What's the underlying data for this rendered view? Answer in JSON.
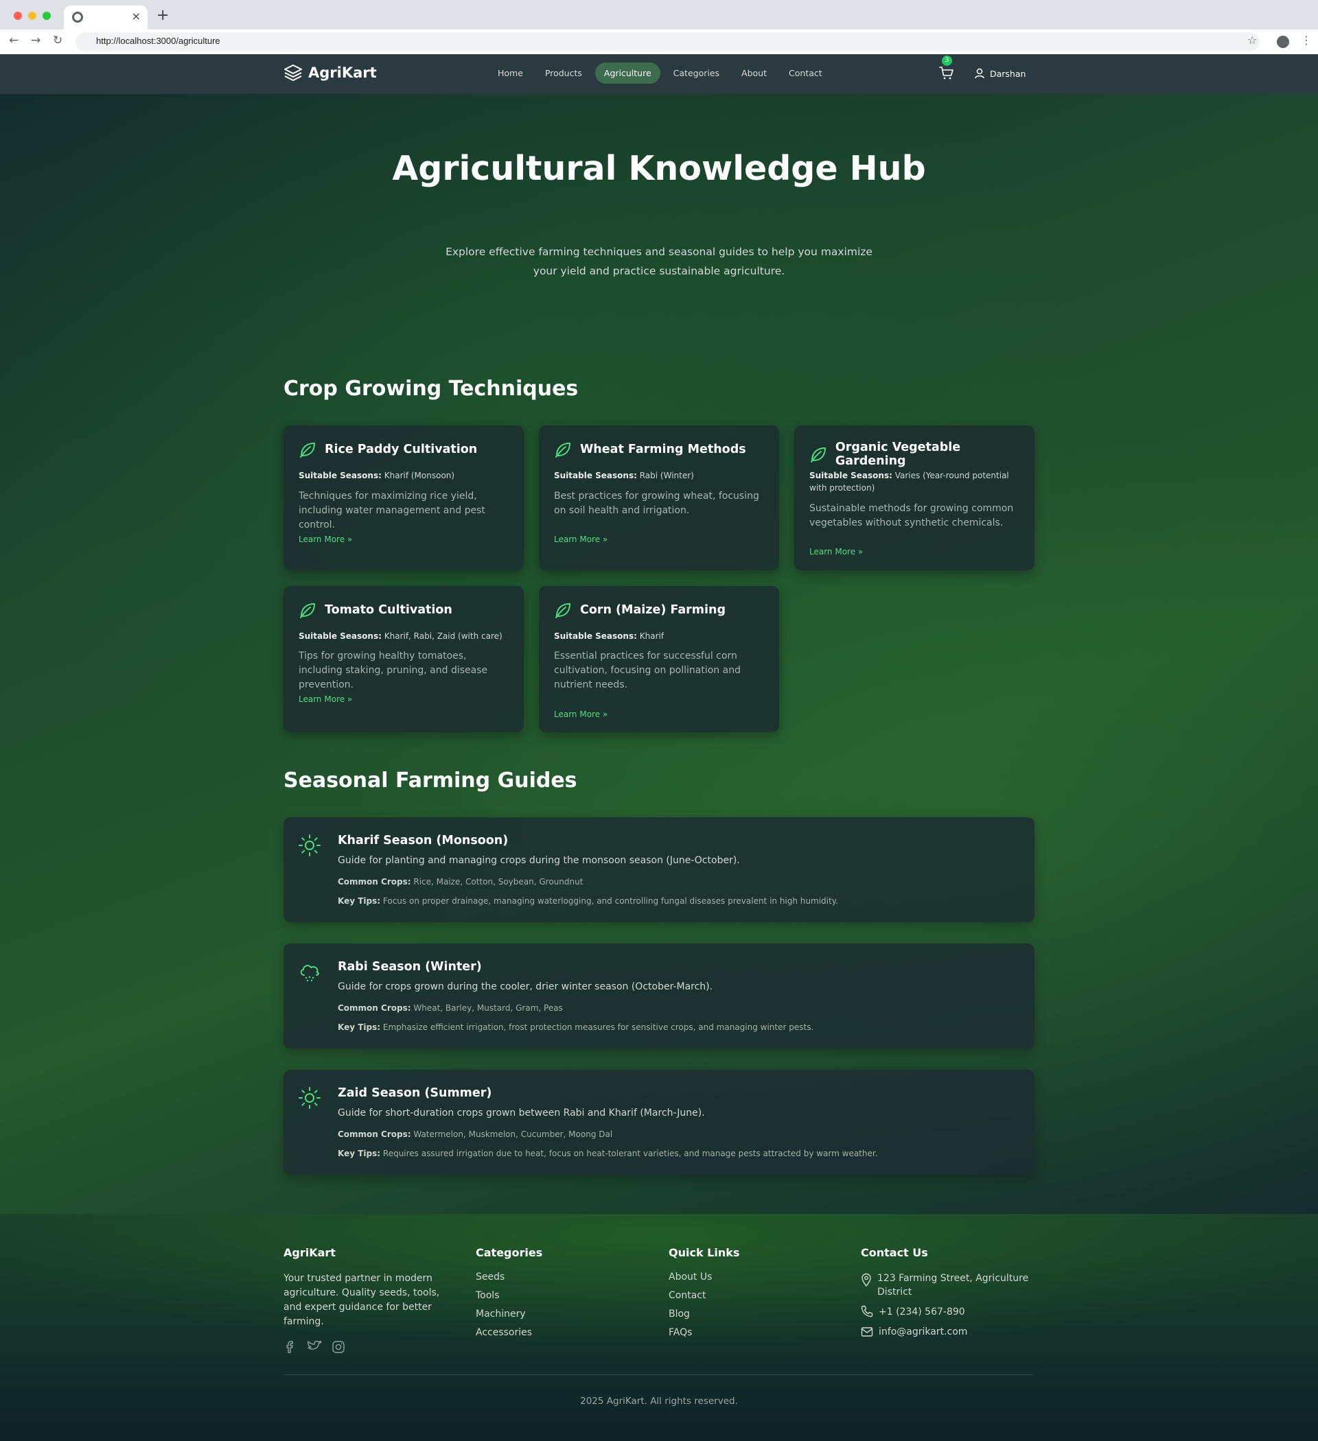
{
  "browser": {
    "url": "http://localhost:3000/agriculture",
    "new_tab": "+",
    "close_tab": "×"
  },
  "header": {
    "brand": "AgriKart",
    "nav": [
      {
        "label": "Home",
        "active": false
      },
      {
        "label": "Products",
        "active": false
      },
      {
        "label": "Agriculture",
        "active": true
      },
      {
        "label": "Categories",
        "active": false
      },
      {
        "label": "About",
        "active": false
      },
      {
        "label": "Contact",
        "active": false
      }
    ],
    "cart_count": "3",
    "user_name": "Darshan"
  },
  "hero": {
    "title": "Agricultural Knowledge Hub",
    "subtitle": "Explore effective farming techniques and seasonal guides to help you maximize your yield and practice sustainable agriculture."
  },
  "techniques": {
    "heading": "Crop Growing Techniques",
    "seasons_label": "Suitable Seasons:",
    "link_label": "Learn More »",
    "cards": [
      {
        "title": "Rice Paddy Cultivation",
        "seasons": "Kharif (Monsoon)",
        "desc": "Techniques for maximizing rice yield, including water management and pest control.",
        "icon": "leaf-icon"
      },
      {
        "title": "Wheat Farming Methods",
        "seasons": "Rabi (Winter)",
        "desc": "Best practices for growing wheat, focusing on soil health and irrigation.",
        "icon": "leaf-icon"
      },
      {
        "title": "Organic Vegetable Gardening",
        "seasons": "Varies (Year-round potential with protection)",
        "desc": "Sustainable methods for growing common vegetables without synthetic chemicals.",
        "icon": "leaf-icon"
      },
      {
        "title": "Tomato Cultivation",
        "seasons": "Kharif, Rabi, Zaid (with care)",
        "desc": "Tips for growing healthy tomatoes, including staking, pruning, and disease prevention.",
        "icon": "leaf-icon"
      },
      {
        "title": "Corn (Maize) Farming",
        "seasons": "Kharif",
        "desc": "Essential practices for successful corn cultivation, focusing on pollination and nutrient needs.",
        "icon": "leaf-icon"
      }
    ]
  },
  "guides": {
    "heading": "Seasonal Farming Guides",
    "crops_label": "Common Crops:",
    "tips_label": "Key Tips:",
    "items": [
      {
        "title": "Kharif Season (Monsoon)",
        "desc": "Guide for planting and managing crops during the monsoon season (June-October).",
        "crops": "Rice, Maize, Cotton, Soybean, Groundnut",
        "tips": "Focus on proper drainage, managing waterlogging, and controlling fungal diseases prevalent in high humidity.",
        "icon": "sun-icon"
      },
      {
        "title": "Rabi Season (Winter)",
        "desc": "Guide for crops grown during the cooler, drier winter season (October-March).",
        "crops": "Wheat, Barley, Mustard, Gram, Peas",
        "tips": "Emphasize efficient irrigation, frost protection measures for sensitive crops, and managing winter pests.",
        "icon": "cloud-drizzle-icon"
      },
      {
        "title": "Zaid Season (Summer)",
        "desc": "Guide for short-duration crops grown between Rabi and Kharif (March-June).",
        "crops": "Watermelon, Muskmelon, Cucumber, Moong Dal",
        "tips": "Requires assured irrigation due to heat, focus on heat-tolerant varieties, and manage pests attracted by warm weather.",
        "icon": "sun-icon"
      }
    ]
  },
  "footer": {
    "about": {
      "heading": "AgriKart",
      "text": "Your trusted partner in modern agriculture. Quality seeds, tools, and expert guidance for better farming."
    },
    "categories": {
      "heading": "Categories",
      "links": [
        "Seeds",
        "Tools",
        "Machinery",
        "Accessories"
      ]
    },
    "quick_links": {
      "heading": "Quick Links",
      "links": [
        "About Us",
        "Contact",
        "Blog",
        "FAQs"
      ]
    },
    "contact": {
      "heading": "Contact Us",
      "address": "123 Farming Street, Agriculture District",
      "phone": "+1 (234) 567-890",
      "email": "info@agrikart.com"
    },
    "copyright": "2025 AgriKart. All rights reserved."
  },
  "colors": {
    "accent": "#4ade80",
    "active_nav": "#3d6b4e",
    "badge": "#22c55e"
  }
}
